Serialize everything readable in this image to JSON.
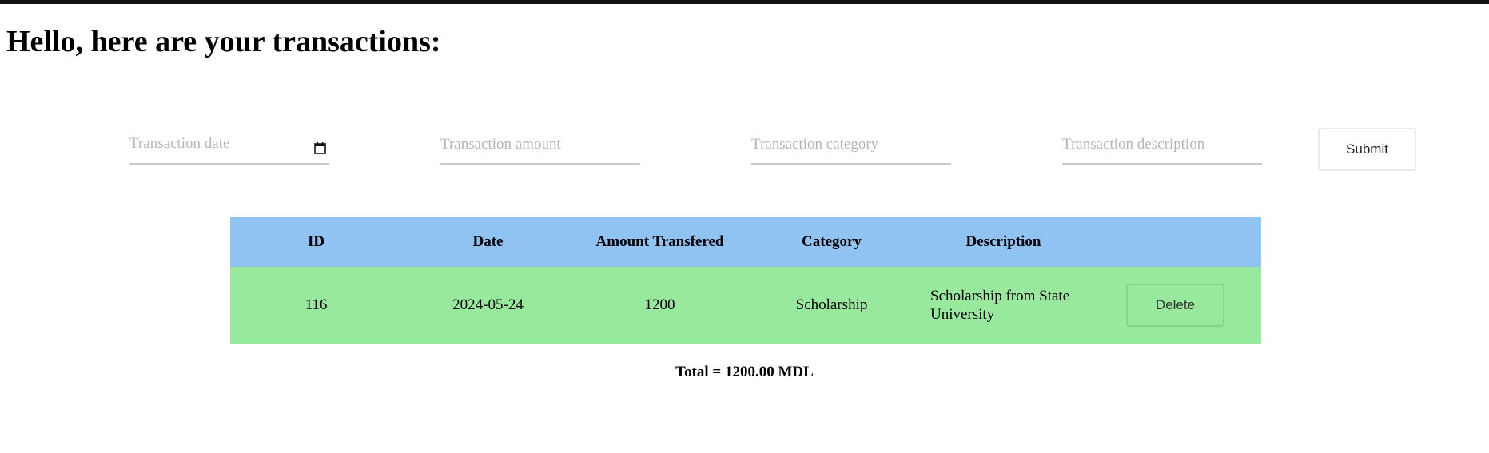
{
  "header": {
    "title": "Hello, here are your transactions:"
  },
  "form": {
    "date_placeholder": "Transaction date",
    "amount_placeholder": "Transaction amount",
    "category_placeholder": "Transaction category",
    "description_placeholder": "Transaction description",
    "submit_label": "Submit"
  },
  "table": {
    "columns": [
      "ID",
      "Date",
      "Amount Transfered",
      "Category",
      "Description",
      ""
    ],
    "rows": [
      {
        "id": "116",
        "date": "2024-05-24",
        "amount": "1200",
        "category": "Scholarship",
        "description": "Scholarship from State University",
        "delete_label": "Delete"
      }
    ]
  },
  "summary": {
    "total_text": "Total = 1200.00 MDL"
  },
  "colors": {
    "header_bg": "#90c2f2",
    "row_bg": "#98e89e"
  },
  "icons": {
    "date_picker": "calendar-icon"
  }
}
